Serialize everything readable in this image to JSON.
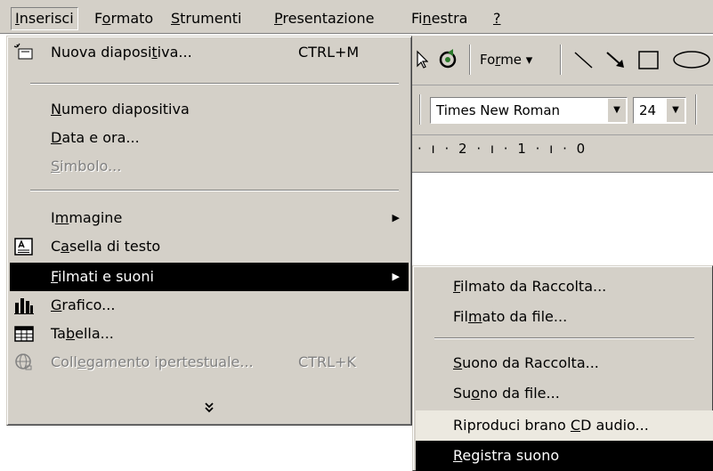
{
  "menubar": {
    "items": [
      {
        "pre": "",
        "key": "I",
        "post": "nserisci"
      },
      {
        "pre": "F",
        "key": "o",
        "post": "rmato"
      },
      {
        "pre": "",
        "key": "S",
        "post": "trumenti"
      },
      {
        "pre": "",
        "key": "P",
        "post": "resentazione"
      },
      {
        "pre": "Fi",
        "key": "n",
        "post": "estra"
      },
      {
        "pre": "",
        "key": "?",
        "post": ""
      }
    ]
  },
  "toolbar": {
    "shapes_pre": "Fo",
    "shapes_key": "r",
    "shapes_post": "me ▾",
    "font_name": "Times New Roman",
    "font_size": "24",
    "ruler_text": "· ı · 2 · ı · 1 · ı · 0"
  },
  "insert_menu": {
    "items": [
      {
        "pre": "Nuova diaposi",
        "key": "t",
        "post": "iva...",
        "shortcut": "CTRL+M"
      },
      {
        "pre": "",
        "key": "N",
        "post": "umero diapositiva"
      },
      {
        "pre": "",
        "key": "D",
        "post": "ata e ora..."
      },
      {
        "pre": "",
        "key": "S",
        "post": "imbolo..."
      },
      {
        "pre": "I",
        "key": "m",
        "post": "magine"
      },
      {
        "pre": "C",
        "key": "a",
        "post": "sella di testo"
      },
      {
        "pre": "",
        "key": "F",
        "post": "ilmati e suoni"
      },
      {
        "pre": "",
        "key": "G",
        "post": "rafico..."
      },
      {
        "pre": "Ta",
        "key": "b",
        "post": "ella..."
      },
      {
        "pre": "Coll",
        "key": "e",
        "post": "gamento ipertestuale...",
        "shortcut": "CTRL+K"
      }
    ],
    "expand_glyph": "¥"
  },
  "submenu": {
    "items": [
      {
        "pre": "",
        "key": "F",
        "post": "ilmato da Raccolta..."
      },
      {
        "pre": "Fil",
        "key": "m",
        "post": "ato da file..."
      },
      {
        "pre": "",
        "key": "S",
        "post": "uono da Raccolta..."
      },
      {
        "pre": "Su",
        "key": "o",
        "post": "no da file..."
      },
      {
        "pre": "Riproduci brano ",
        "key": "C",
        "post": "D audio..."
      },
      {
        "pre": "",
        "key": "R",
        "post": "egistra suono"
      }
    ]
  }
}
